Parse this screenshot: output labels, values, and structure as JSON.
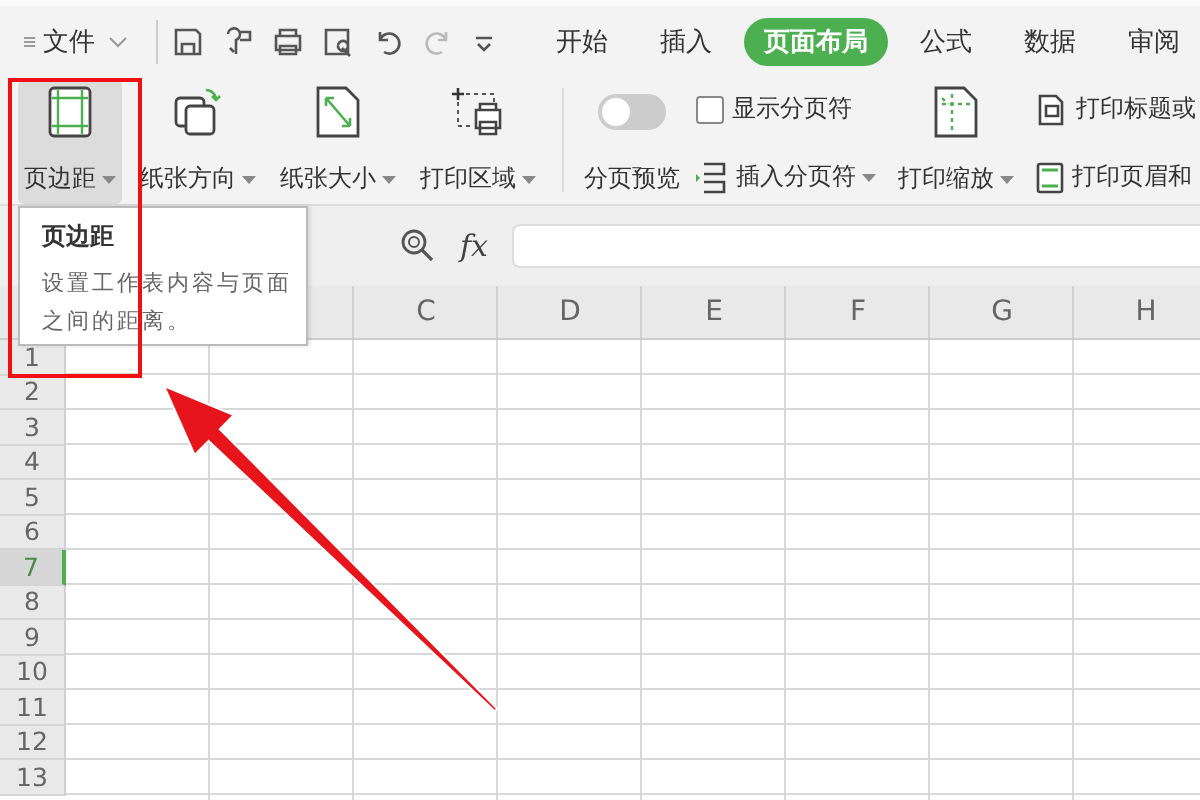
{
  "menu": {
    "label": "文件"
  },
  "tabs": [
    {
      "label": "开始",
      "selected": false
    },
    {
      "label": "插入",
      "selected": false
    },
    {
      "label": "页面布局",
      "selected": true
    },
    {
      "label": "公式",
      "selected": false
    },
    {
      "label": "数据",
      "selected": false
    },
    {
      "label": "审阅",
      "selected": false
    }
  ],
  "ribbon": {
    "groups": [
      {
        "items": [
          {
            "kind": "large",
            "label": "页边距",
            "caret": true,
            "hovered": true
          },
          {
            "kind": "large",
            "label": "纸张方向",
            "caret": true,
            "hovered": false
          },
          {
            "kind": "large",
            "label": "纸张大小",
            "caret": true,
            "hovered": false
          },
          {
            "kind": "large",
            "label": "打印区域",
            "caret": true,
            "hovered": false
          }
        ]
      },
      {
        "items": [
          {
            "kind": "toggle",
            "label": "分页预览",
            "on": false
          },
          {
            "kind": "stack",
            "items": [
              {
                "kind": "checkbox",
                "label": "显示分页符",
                "checked": false
              },
              {
                "kind": "small",
                "label": "插入分页符",
                "caret": true
              }
            ]
          },
          {
            "kind": "large",
            "label": "打印缩放",
            "caret": true,
            "hovered": false
          },
          {
            "kind": "stack",
            "items": [
              {
                "kind": "small",
                "label": "打印标题或",
                "caret": false
              },
              {
                "kind": "small",
                "label": "打印页眉和",
                "caret": false
              }
            ]
          }
        ]
      }
    ]
  },
  "formula_bar": {
    "fx": "fx"
  },
  "tooltip": {
    "title": "页边距",
    "text": "设置工作表内容与页面之间的距离。"
  },
  "grid": {
    "columns": [
      "C",
      "D",
      "E",
      "F",
      "G",
      "H"
    ],
    "rows": [
      {
        "label": "1",
        "selected": false
      },
      {
        "label": "2",
        "selected": false
      },
      {
        "label": "3",
        "selected": false
      },
      {
        "label": "4",
        "selected": false
      },
      {
        "label": "5",
        "selected": false
      },
      {
        "label": "6",
        "selected": false
      },
      {
        "label": "7",
        "selected": true
      },
      {
        "label": "8",
        "selected": false
      },
      {
        "label": "9",
        "selected": false
      },
      {
        "label": "10",
        "selected": false
      },
      {
        "label": "11",
        "selected": false
      },
      {
        "label": "12",
        "selected": false
      },
      {
        "label": "13",
        "selected": false
      }
    ]
  }
}
